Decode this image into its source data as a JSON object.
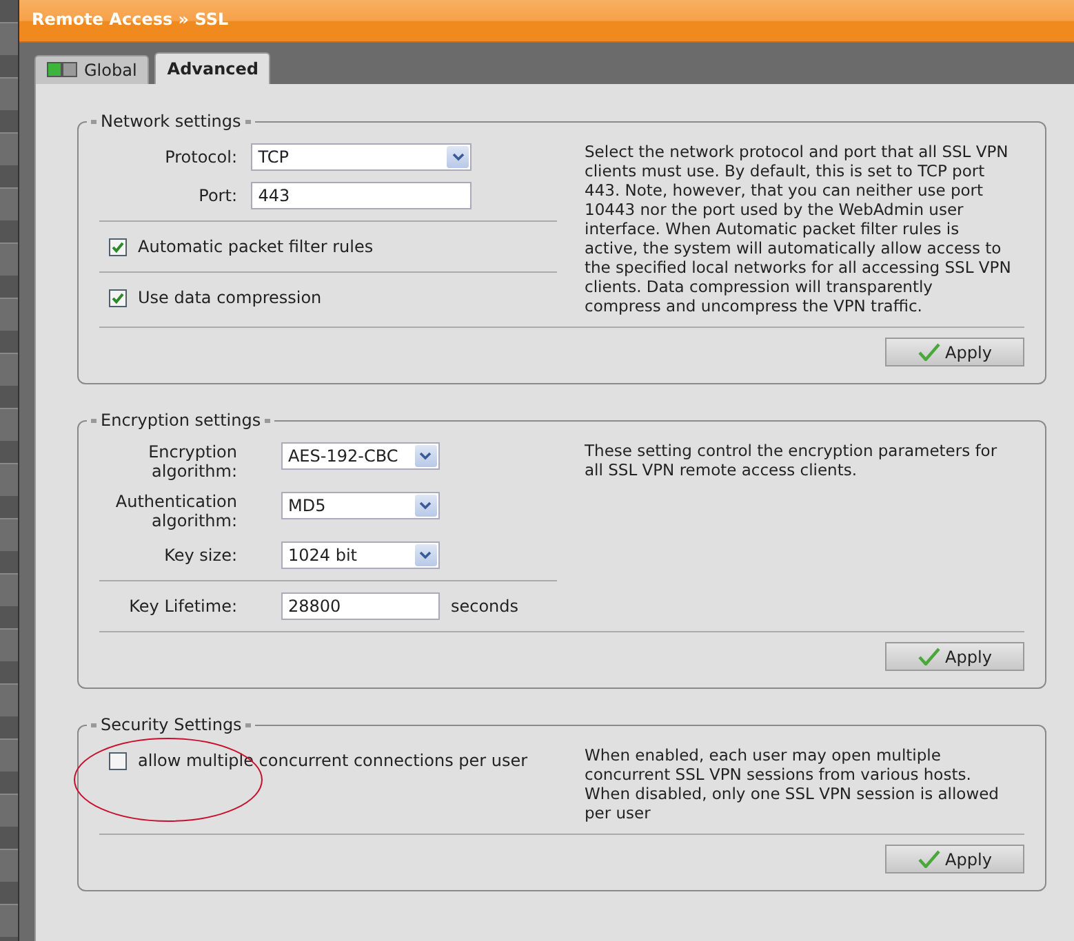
{
  "breadcrumb": "Remote Access » SSL",
  "tabs": [
    {
      "label": "Global",
      "selected": false,
      "icon": true
    },
    {
      "label": "Advanced",
      "selected": true,
      "icon": false
    }
  ],
  "sections": [
    {
      "title": "Network settings",
      "groups": [
        [
          {
            "kind": "select",
            "label": "Protocol:",
            "value": "TCP"
          },
          {
            "kind": "text",
            "label": "Port:",
            "value": "443"
          }
        ],
        [
          {
            "kind": "checkbox",
            "label": "Automatic packet filter rules",
            "checked": true
          }
        ],
        [
          {
            "kind": "checkbox",
            "label": "Use data compression",
            "checked": true
          }
        ]
      ],
      "description": "Select the network protocol and port that all SSL VPN clients must use. By default, this is set to TCP port 443. Note, however, that you can neither use port 10443 nor the port used by the WebAdmin user interface. When Automatic packet filter rules is active, the system will automatically allow access to the specified local networks for all accessing SSL VPN clients. Data compression will transparently compress and uncompress the VPN traffic.",
      "button": "Apply"
    },
    {
      "title": "Encryption settings",
      "groups": [
        [
          {
            "kind": "select",
            "label": "Encryption algorithm:",
            "value": "AES-192-CBC"
          },
          {
            "kind": "select",
            "label": "Authentication algorithm:",
            "value": "MD5"
          },
          {
            "kind": "select",
            "label": "Key size:",
            "value": "1024 bit"
          }
        ],
        [
          {
            "kind": "text",
            "label": "Key Lifetime:",
            "value": "28800",
            "unit": "seconds"
          }
        ]
      ],
      "description": "These setting control the encryption parameters for all SSL VPN remote access clients.",
      "button": "Apply"
    },
    {
      "title": "Security Settings",
      "groups": [
        [
          {
            "kind": "checkbox",
            "label": "allow multiple concurrent connections per user",
            "checked": false
          }
        ]
      ],
      "description": "When enabled, each user may open multiple concurrent SSL VPN sessions from various hosts. When disabled, only one SSL VPN session is allowed per user",
      "button": "Apply"
    }
  ]
}
